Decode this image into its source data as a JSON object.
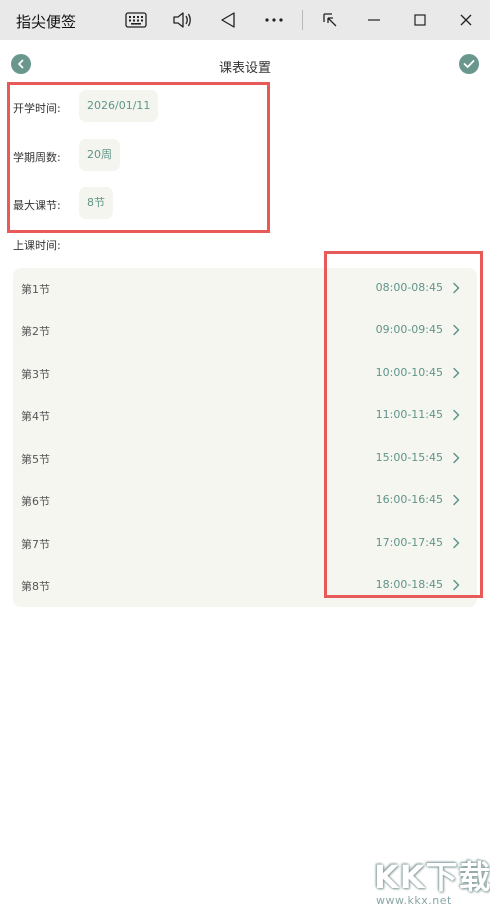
{
  "window": {
    "title": "指尖便签"
  },
  "header": {
    "title": "课表设置"
  },
  "settings": {
    "start_label": "开学时间:",
    "start_value": "2026/01/11",
    "weeks_label": "学期周数:",
    "weeks_value": "20周",
    "max_label": "最大课节:",
    "max_value": "8节",
    "schedule_label": "上课时间:"
  },
  "lessons": [
    {
      "name": "第1节",
      "time": "08:00-08:45"
    },
    {
      "name": "第2节",
      "time": "09:00-09:45"
    },
    {
      "name": "第3节",
      "time": "10:00-10:45"
    },
    {
      "name": "第4节",
      "time": "11:00-11:45"
    },
    {
      "name": "第5节",
      "time": "15:00-15:45"
    },
    {
      "name": "第6节",
      "time": "16:00-16:45"
    },
    {
      "name": "第7节",
      "time": "17:00-17:45"
    },
    {
      "name": "第8节",
      "time": "18:00-18:45"
    }
  ],
  "watermark": {
    "brand": "KK下载",
    "url": "www.kkx.net"
  },
  "colors": {
    "accent": "#5f948a",
    "annotation": "#e85a5a",
    "card": "#f6f6f1"
  },
  "icons": {
    "back": "chevron-left-circle-icon",
    "confirm": "check-circle-icon",
    "row": "chevron-right-icon"
  }
}
